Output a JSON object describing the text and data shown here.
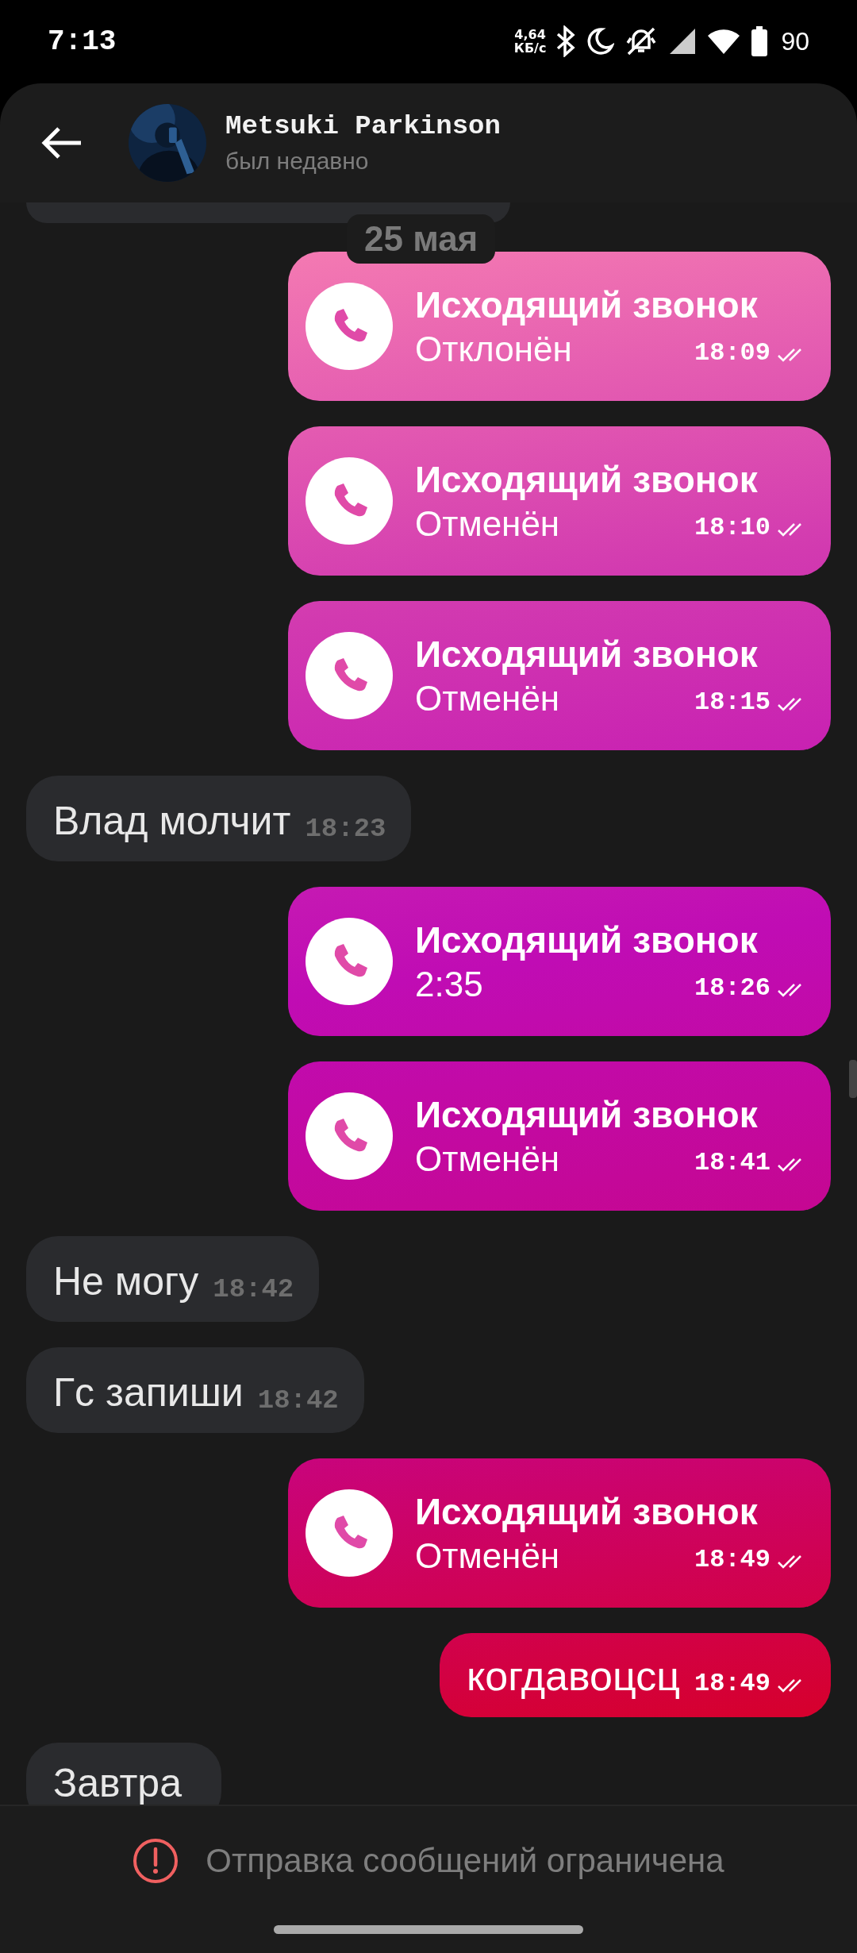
{
  "status_bar": {
    "time": "7:13",
    "net_speed_value": "4,64",
    "net_speed_unit": "КБ/с",
    "battery": "90"
  },
  "header": {
    "name": "Metsuki Parkinson",
    "status": "был недавно"
  },
  "date_chip": "25 мая",
  "messages": [
    {
      "kind": "incoming_cut"
    },
    {
      "kind": "call",
      "title": "Исходящий звонок",
      "status": "Отклонён",
      "time": "18:09",
      "read": true
    },
    {
      "kind": "call",
      "title": "Исходящий звонок",
      "status": "Отменён",
      "time": "18:10",
      "read": true
    },
    {
      "kind": "call",
      "title": "Исходящий звонок",
      "status": "Отменён",
      "time": "18:15",
      "read": true
    },
    {
      "kind": "incoming",
      "text": "Влад молчит",
      "time": "18:23"
    },
    {
      "kind": "call",
      "title": "Исходящий звонок",
      "status": "2:35",
      "time": "18:26",
      "read": true
    },
    {
      "kind": "call",
      "title": "Исходящий звонок",
      "status": "Отменён",
      "time": "18:41",
      "read": true
    },
    {
      "kind": "incoming",
      "text": "Не могу",
      "time": "18:42"
    },
    {
      "kind": "incoming",
      "text": "Гс запиши",
      "time": "18:42"
    },
    {
      "kind": "call",
      "title": "Исходящий звонок",
      "status": "Отменён",
      "time": "18:49",
      "read": true
    },
    {
      "kind": "outgoing",
      "text": "когдавоцсц",
      "time": "18:49",
      "read": true
    },
    {
      "kind": "incoming",
      "text": "Завтра"
    }
  ],
  "notice": "Отправка сообщений ограничена"
}
